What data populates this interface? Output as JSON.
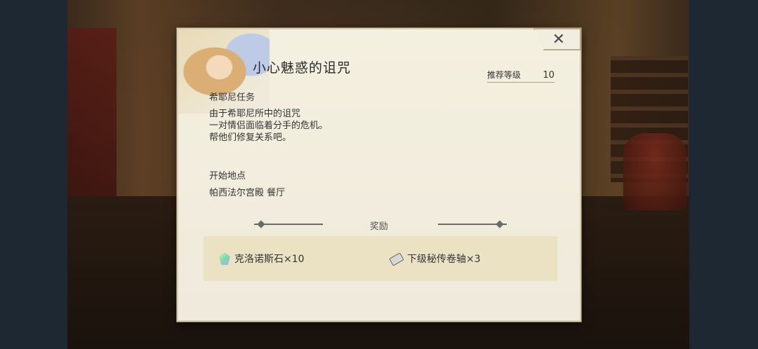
{
  "dialog": {
    "title": "小心魅惑的诅咒",
    "close_icon": "✕",
    "recommended_level_label": "推荐等级",
    "recommended_level_value": "10",
    "quest_type": "希耶尼任务",
    "description": [
      "由于希耶尼所中的诅咒",
      "一对情侣面临着分手的危机。",
      "帮他们修复关系吧。"
    ],
    "start_location_label": "开始地点",
    "start_location_value": "帕西法尔宫殿 餐厅",
    "reward_label": "奖励",
    "rewards": [
      {
        "icon": "crystal-icon",
        "text": "克洛诺斯石×10"
      },
      {
        "icon": "scroll-icon",
        "text": "下级秘传卷轴×3"
      }
    ]
  }
}
